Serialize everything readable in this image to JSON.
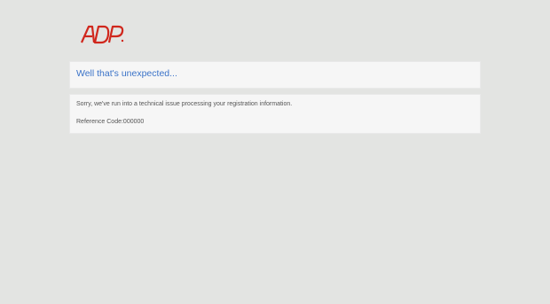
{
  "brand": {
    "logo_name": "ADP",
    "logo_color": "#d0271d"
  },
  "error": {
    "title": "Well that's unexpected...",
    "message": "Sorry, we've run into a technical issue processing your registration information.",
    "reference": "Reference Code:000000"
  },
  "colors": {
    "background": "#e3e4e2",
    "panel": "#f6f6f6",
    "title_text": "#3b73c8",
    "body_text": "#555555"
  }
}
